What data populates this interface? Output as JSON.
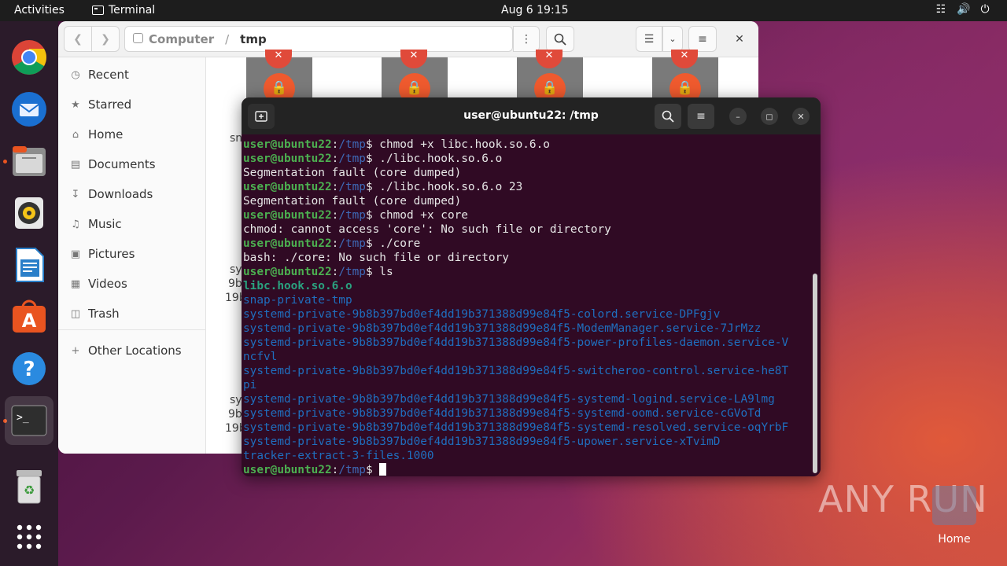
{
  "topbar": {
    "activities": "Activities",
    "app_name": "Terminal",
    "clock": "Aug 6  19:15",
    "tray_icons": [
      "network-icon",
      "volume-icon",
      "power-icon"
    ]
  },
  "dock": {
    "items": [
      "chrome-icon",
      "thunderbird-icon",
      "files-icon",
      "rhythmbox-icon",
      "libreoffice-writer-icon",
      "app-center-icon",
      "help-icon",
      "terminal-icon",
      "trash-icon",
      "app-grid-icon"
    ]
  },
  "files": {
    "path": [
      "Computer",
      "tmp"
    ],
    "sidebar": [
      {
        "label": "Recent",
        "icon": "clock-icon"
      },
      {
        "label": "Starred",
        "icon": "star-icon"
      },
      {
        "label": "Home",
        "icon": "home-icon"
      },
      {
        "label": "Documents",
        "icon": "document-icon"
      },
      {
        "label": "Downloads",
        "icon": "download-icon"
      },
      {
        "label": "Music",
        "icon": "music-icon"
      },
      {
        "label": "Pictures",
        "icon": "picture-icon"
      },
      {
        "label": "Videos",
        "icon": "video-icon"
      },
      {
        "label": "Trash",
        "icon": "trash-icon"
      },
      {
        "label": "Other Locations",
        "icon": "plus-icon"
      }
    ],
    "clipped_labels": [
      "sn",
      "sy",
      "9b",
      "19b",
      "sy",
      "9b",
      "19b"
    ]
  },
  "terminal": {
    "title": "user@ubuntu22: /tmp",
    "prompt_user": "user@ubuntu22",
    "prompt_path": "/tmp",
    "lines": [
      {
        "type": "cmd",
        "text": " chmod +x libc.hook.so.6.o"
      },
      {
        "type": "cmd",
        "text": " ./libc.hook.so.6.o"
      },
      {
        "type": "out",
        "text": "Segmentation fault (core dumped)"
      },
      {
        "type": "cmd",
        "text": " ./libc.hook.so.6.o 23"
      },
      {
        "type": "out",
        "text": "Segmentation fault (core dumped)"
      },
      {
        "type": "cmd",
        "text": " chmod +x core"
      },
      {
        "type": "out",
        "text": "chmod: cannot access 'core': No such file or directory"
      },
      {
        "type": "cmd",
        "text": " ./core"
      },
      {
        "type": "out",
        "text": "bash: ./core: No such file or directory"
      },
      {
        "type": "cmd",
        "text": " ls"
      },
      {
        "type": "exe",
        "text": "libc.hook.so.6.o"
      },
      {
        "type": "dir",
        "text": "snap-private-tmp"
      },
      {
        "type": "dir",
        "text": "systemd-private-9b8b397bd0ef4dd19b371388d99e84f5-colord.service-DPFgjv"
      },
      {
        "type": "dir",
        "text": "systemd-private-9b8b397bd0ef4dd19b371388d99e84f5-ModemManager.service-7JrMzz"
      },
      {
        "type": "dir",
        "text": "systemd-private-9b8b397bd0ef4dd19b371388d99e84f5-power-profiles-daemon.service-V"
      },
      {
        "type": "dir",
        "text": "ncfvl"
      },
      {
        "type": "dir",
        "text": "systemd-private-9b8b397bd0ef4dd19b371388d99e84f5-switcheroo-control.service-he8T"
      },
      {
        "type": "dir",
        "text": "pi"
      },
      {
        "type": "dir",
        "text": "systemd-private-9b8b397bd0ef4dd19b371388d99e84f5-systemd-logind.service-LA9lmg"
      },
      {
        "type": "dir",
        "text": "systemd-private-9b8b397bd0ef4dd19b371388d99e84f5-systemd-oomd.service-cGVoTd"
      },
      {
        "type": "dir",
        "text": "systemd-private-9b8b397bd0ef4dd19b371388d99e84f5-systemd-resolved.service-oqYrbF"
      },
      {
        "type": "dir",
        "text": "systemd-private-9b8b397bd0ef4dd19b371388d99e84f5-upower.service-xTvimD"
      },
      {
        "type": "dir",
        "text": "tracker-extract-3-files.1000"
      },
      {
        "type": "prompt",
        "text": ""
      }
    ]
  },
  "desktop": {
    "watermark": "ANY RUN",
    "home_label": "Home"
  }
}
